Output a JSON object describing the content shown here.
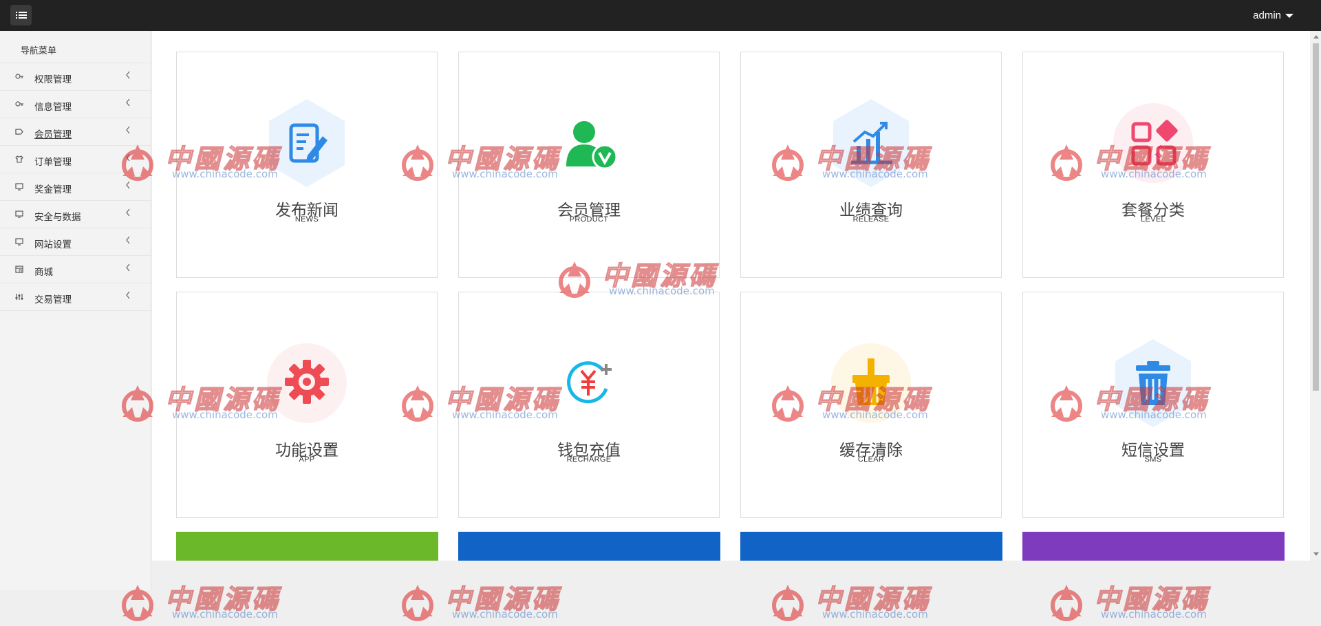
{
  "header": {
    "user_name": "admin"
  },
  "sidebar": {
    "title": "导航菜单",
    "items": [
      {
        "label": "权限管理",
        "icon": "key-icon"
      },
      {
        "label": "信息管理",
        "icon": "key-icon"
      },
      {
        "label": "会员管理",
        "icon": "tag-icon"
      },
      {
        "label": "订单管理",
        "icon": "shirt-icon"
      },
      {
        "label": "奖金管理",
        "icon": "monitor-icon"
      },
      {
        "label": "安全与数据",
        "icon": "monitor-icon"
      },
      {
        "label": "网站设置",
        "icon": "monitor-icon"
      },
      {
        "label": "商城",
        "icon": "store-icon"
      },
      {
        "label": "交易管理",
        "icon": "sliders-icon"
      }
    ]
  },
  "cards": [
    {
      "title": "发布新闻",
      "sub": "NEWS"
    },
    {
      "title": "会员管理",
      "sub": "PRODUCT"
    },
    {
      "title": "业绩查询",
      "sub": "RELEASE"
    },
    {
      "title": "套餐分类",
      "sub": "LEVEL"
    },
    {
      "title": "功能设置",
      "sub": "APP"
    },
    {
      "title": "钱包充值",
      "sub": "RECHARGE"
    },
    {
      "title": "缓存清除",
      "sub": "CLEAR"
    },
    {
      "title": "短信设置",
      "sub": "SMS"
    }
  ],
  "watermark": {
    "text": "中國源碼",
    "url": "www.chinacode.com"
  },
  "colors": {
    "topbar": "#222222",
    "tile_green": "#6bb82a",
    "tile_blue": "#1164c6",
    "tile_purple": "#7e3bbd"
  }
}
